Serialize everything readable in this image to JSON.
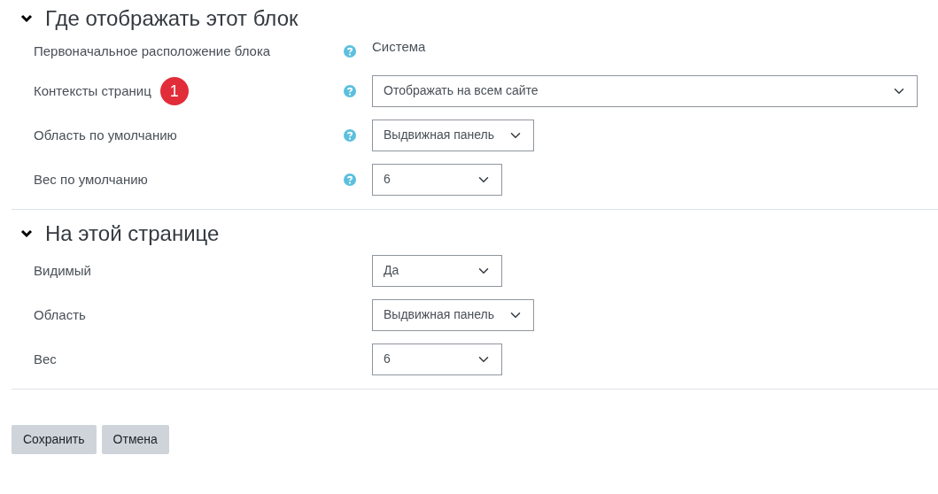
{
  "sections": [
    {
      "title": "Где отображать этот блок",
      "expanded": true,
      "fields": [
        {
          "label": "Первоначальное расположение блока",
          "help": true,
          "kind": "static",
          "value": "Система"
        },
        {
          "label": "Контексты страниц",
          "badge": "1",
          "help": true,
          "kind": "select",
          "wide": true,
          "value": "Отображать на всем сайте"
        },
        {
          "label": "Область по умолчанию",
          "help": true,
          "kind": "select",
          "wide": false,
          "value": "Выдвижная панель"
        },
        {
          "label": "Вес по умолчанию",
          "help": true,
          "kind": "select",
          "wide": false,
          "value": "6"
        }
      ]
    },
    {
      "title": "На этой странице",
      "expanded": true,
      "fields": [
        {
          "label": "Видимый",
          "help": false,
          "kind": "select",
          "wide": false,
          "value": "Да"
        },
        {
          "label": "Область",
          "help": false,
          "kind": "select",
          "wide": false,
          "value": "Выдвижная панель"
        },
        {
          "label": "Вес",
          "help": false,
          "kind": "select",
          "wide": false,
          "value": "6"
        }
      ]
    }
  ],
  "buttons": [
    "Сохранить",
    "Отмена"
  ]
}
